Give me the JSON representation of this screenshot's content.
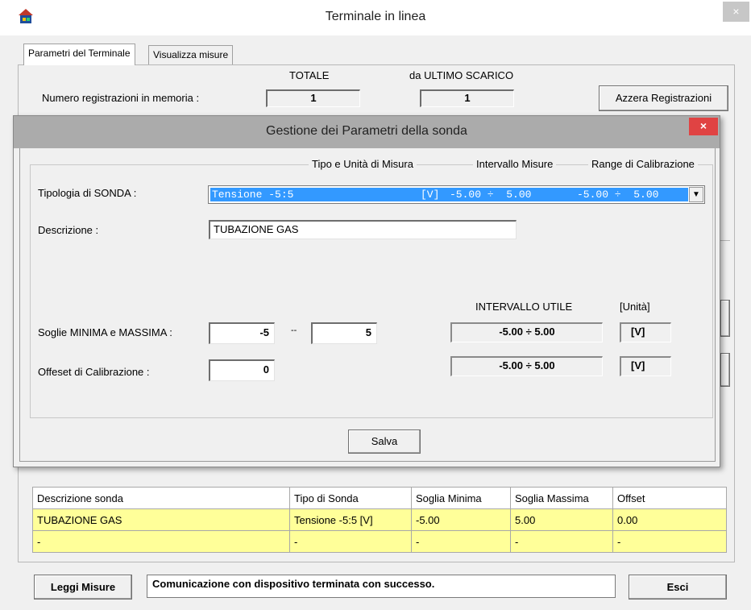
{
  "window": {
    "title": "Terminale in linea",
    "close_glyph": "×",
    "app_icon": "house-network-icon"
  },
  "tabs": [
    {
      "label": "Parametri del Terminale",
      "active": true
    },
    {
      "label": "Visualizza misure",
      "active": false
    }
  ],
  "memory": {
    "label": "Numero registrazioni in memoria :",
    "total_header": "TOTALE",
    "last_header": "da ULTIMO SCARICO",
    "total_value": "1",
    "last_value": "1",
    "reset_button": "Azzera Registrazioni"
  },
  "dialog": {
    "title": "Gestione dei Parametri della sonda",
    "close_glyph": "×",
    "col_type": "Tipo e Unità di Misura",
    "col_interval": "Intervallo Misure",
    "col_range": "Range di Calibrazione",
    "probe_type_label": "Tipologia di SONDA :",
    "probe_select": {
      "name": "Tensione -5:5",
      "unit": "[V]",
      "interval": "-5.00 ÷  5.00",
      "range": "-5.00 ÷  5.00"
    },
    "description_label": "Descrizione :",
    "description_value": "TUBAZIONE GAS",
    "useful_interval_header": "INTERVALLO UTILE",
    "unit_header": "[Unità]",
    "thresholds_label": "Soglie MINIMA e MASSIMA :",
    "min_value": "-5",
    "separator": "--",
    "max_value": "5",
    "threshold_interval": "-5.00 ÷  5.00",
    "threshold_unit": "[V]",
    "offset_label": "Offeset di Calibrazione :",
    "offset_value": "0",
    "offset_interval": "-5.00 ÷  5.00",
    "offset_unit": "[V]",
    "save_button": "Salva"
  },
  "table": {
    "headers": [
      "Descrizione sonda",
      "Tipo di Sonda",
      "Soglia Minima",
      "Soglia Massima",
      "Offset"
    ],
    "rows": [
      [
        "TUBAZIONE GAS",
        "Tensione  -5:5 [V]",
        "-5.00",
        "5.00",
        "0.00"
      ],
      [
        "-",
        "-",
        "-",
        "-",
        "-"
      ]
    ],
    "row_color": "#ffff99"
  },
  "bottom": {
    "read_button": "Leggi Misure",
    "status": "Comunicazione con dispositivo terminata con successo.",
    "exit_button": "Esci"
  },
  "colors": {
    "selection": "#3399ff",
    "dialog_close": "#e04343"
  }
}
